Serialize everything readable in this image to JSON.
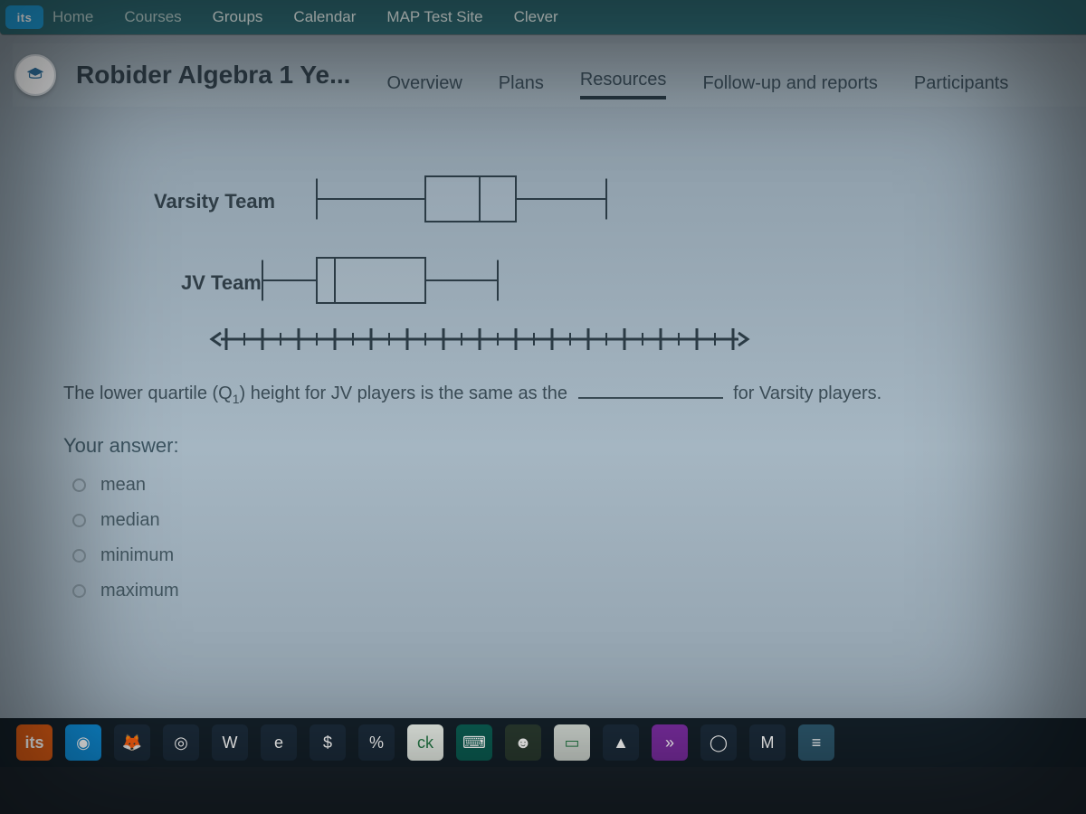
{
  "topnav": {
    "corner_label": "its",
    "items": [
      "Home",
      "Courses",
      "Groups",
      "Calendar",
      "MAP Test Site",
      "Clever"
    ]
  },
  "course": {
    "title": "Robider Algebra 1 Ye...",
    "tabs": [
      "Overview",
      "Plans",
      "Resources",
      "Follow-up and reports",
      "Participants"
    ],
    "active_tab_index": 2
  },
  "plot": {
    "series": [
      {
        "label": "Varsity Team"
      },
      {
        "label": "JV Team"
      }
    ]
  },
  "question": {
    "before": "The lower quartile (Q",
    "sub": "1",
    "mid": ") height for JV players is the same as the",
    "after": "for Varsity players."
  },
  "answer_heading": "Your answer:",
  "options": [
    "mean",
    "median",
    "minimum",
    "maximum"
  ],
  "taskbar": {
    "start": "its",
    "icons": [
      {
        "name": "camera",
        "bg": "#0f8bd4",
        "glyph": "◉"
      },
      {
        "name": "firefox",
        "bg": "#1b2b3a",
        "glyph": "🦊"
      },
      {
        "name": "chrome",
        "bg": "#1b2b3a",
        "glyph": "◎"
      },
      {
        "name": "word",
        "bg": "#1b2b3a",
        "glyph": "W"
      },
      {
        "name": "edge",
        "bg": "#1b2b3a",
        "glyph": "e"
      },
      {
        "name": "money",
        "bg": "#1b2b3a",
        "glyph": "$"
      },
      {
        "name": "percent",
        "bg": "#1b2b3a",
        "glyph": "%"
      },
      {
        "name": "ck12",
        "bg": "#e7ede6",
        "glyph": "ck"
      },
      {
        "name": "typing",
        "bg": "#0b5d52",
        "glyph": "⌨"
      },
      {
        "name": "contacts",
        "bg": "#2a3a2f",
        "glyph": "☻"
      },
      {
        "name": "calc",
        "bg": "#cfd6d0",
        "glyph": "▭"
      },
      {
        "name": "drive",
        "bg": "#1b2b3a",
        "glyph": "▲"
      },
      {
        "name": "note",
        "bg": "#7a2da0",
        "glyph": "»"
      },
      {
        "name": "browser",
        "bg": "#1b2b3a",
        "glyph": "◯"
      },
      {
        "name": "gmail",
        "bg": "#1b2b3a",
        "glyph": "M"
      },
      {
        "name": "docs",
        "bg": "#2c566b",
        "glyph": "≡"
      }
    ]
  },
  "chart_data": {
    "type": "boxplot",
    "title": "",
    "xlabel": "",
    "ylabel": "",
    "xlim": [
      0,
      28
    ],
    "series": [
      {
        "name": "Varsity Team",
        "min": 5,
        "q1": 11,
        "median": 14,
        "q3": 16,
        "max": 21
      },
      {
        "name": "JV Team",
        "min": 2,
        "q1": 5,
        "median": 6,
        "q3": 11,
        "max": 15
      }
    ],
    "axis_ticks": {
      "x_major_every": 2,
      "x_minor_every": 1,
      "x_range": [
        0,
        28
      ]
    }
  }
}
